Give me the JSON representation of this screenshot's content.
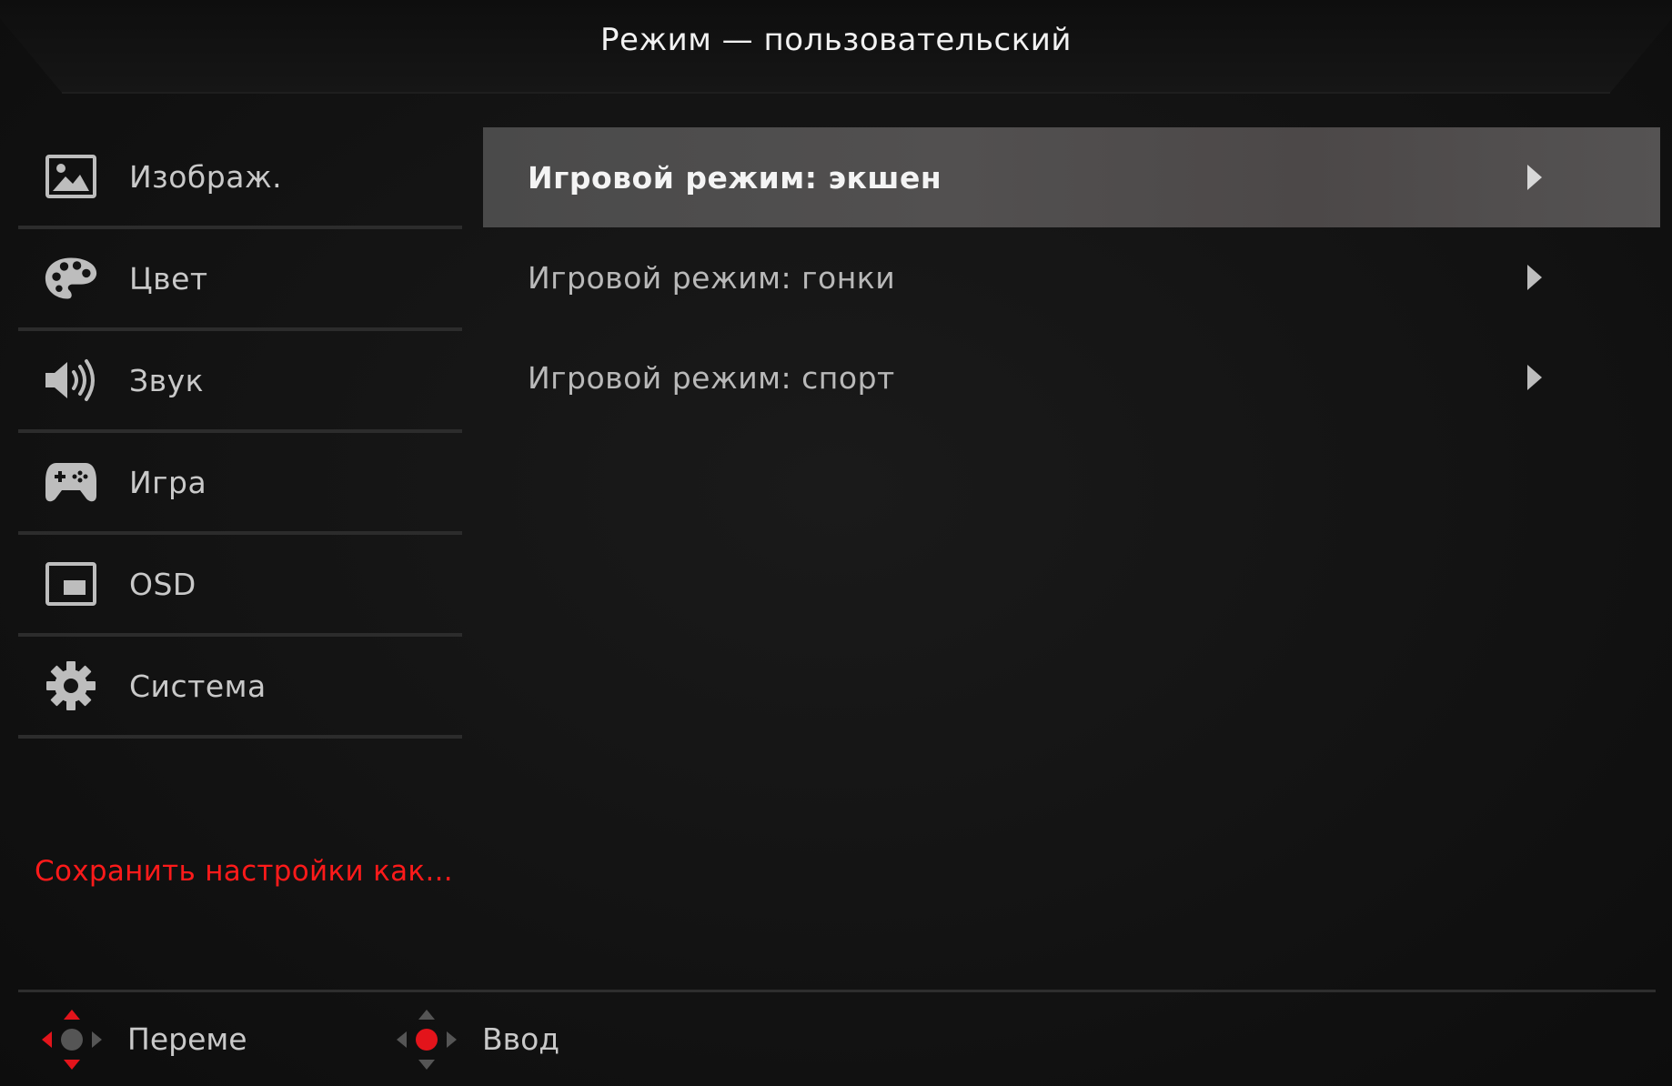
{
  "header": {
    "title": "Режим — пользовательский"
  },
  "sidebar": {
    "items": [
      {
        "label": "Изображ.",
        "icon": "image-icon"
      },
      {
        "label": "Цвет",
        "icon": "palette-icon"
      },
      {
        "label": "Звук",
        "icon": "speaker-icon"
      },
      {
        "label": "Игра",
        "icon": "gamepad-icon"
      },
      {
        "label": "OSD",
        "icon": "osd-icon"
      },
      {
        "label": "Система",
        "icon": "gear-icon"
      }
    ],
    "save_label": "Сохранить настройки как..."
  },
  "panel": {
    "items": [
      {
        "label": "Игровой режим: экшен",
        "selected": true
      },
      {
        "label": "Игровой режим: гонки",
        "selected": false
      },
      {
        "label": "Игровой режим: спорт",
        "selected": false
      }
    ]
  },
  "footer": {
    "move_label": "Переме",
    "enter_label": "Ввод"
  },
  "colors": {
    "accent": "#ff1a1a",
    "background": "#131313",
    "selected_row": "#4d4b4b"
  }
}
